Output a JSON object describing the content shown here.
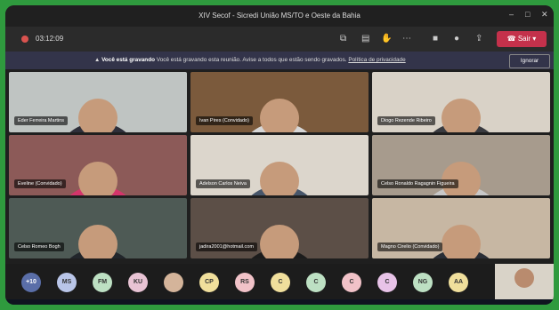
{
  "window": {
    "title": "XIV Secof - Sicredi União MS/TO e Oeste da Bahia",
    "minimize": "–",
    "maximize": "□",
    "close": "✕"
  },
  "toolbar": {
    "timer": "03:12:09",
    "leave_label": "Sair",
    "leave_color": "#c4314b"
  },
  "banner": {
    "title": "Você está gravando",
    "message": "Você está gravando esta reunião. Avise a todos que estão sendo gravados.",
    "link": "Política de privacidade",
    "ignore": "Ignorar"
  },
  "participants": [
    {
      "name": "Eder Ferreira Martins",
      "bg": "#bfc4c2",
      "shirt": "#2e2f3a"
    },
    {
      "name": "Ivan Pires (Convidado)",
      "bg": "#7b5a3c",
      "shirt": "#d7d7d7"
    },
    {
      "name": "Diogo Rezende Ribeiro",
      "bg": "#d9d2c7",
      "shirt": "#3a3b40"
    },
    {
      "name": "Eveline (Convidado)",
      "bg": "#8c5a58",
      "shirt": "#d4356b"
    },
    {
      "name": "Adelson Carlos Neiva",
      "bg": "#dcd6cc",
      "shirt": "#47566a"
    },
    {
      "name": "Celso Ronaldo Ragagnin Figueira",
      "bg": "#a79b8d",
      "shirt": "#c8c8c8"
    },
    {
      "name": "Celso Romeo Bogh",
      "bg": "#4e5a55",
      "shirt": "#22262b"
    },
    {
      "name": "jadira2001@hotmail.com",
      "bg": "#5c4f47",
      "shirt": "#1c1c1c"
    },
    {
      "name": "Magno Cirelio (Convidado)",
      "bg": "#c7b7a3",
      "shirt": "#2a2e36"
    }
  ],
  "attendees": [
    {
      "initials": "+10",
      "color": "#5a6ea8"
    },
    {
      "initials": "MS",
      "color": "#b9c5e8"
    },
    {
      "initials": "FM",
      "color": "#bde0c3"
    },
    {
      "initials": "KU",
      "color": "#e8c3d4"
    },
    {
      "initials": "",
      "color": "#d4b49a"
    },
    {
      "initials": "CP",
      "color": "#f0df9c"
    },
    {
      "initials": "RS",
      "color": "#f1c2c8"
    },
    {
      "initials": "C",
      "color": "#f0df9c"
    },
    {
      "initials": "C",
      "color": "#bde0c3"
    },
    {
      "initials": "C",
      "color": "#f1c2c8"
    },
    {
      "initials": "C",
      "color": "#e8c3e8"
    },
    {
      "initials": "NG",
      "color": "#bde0c3"
    },
    {
      "initials": "AA",
      "color": "#f0df9c"
    }
  ]
}
